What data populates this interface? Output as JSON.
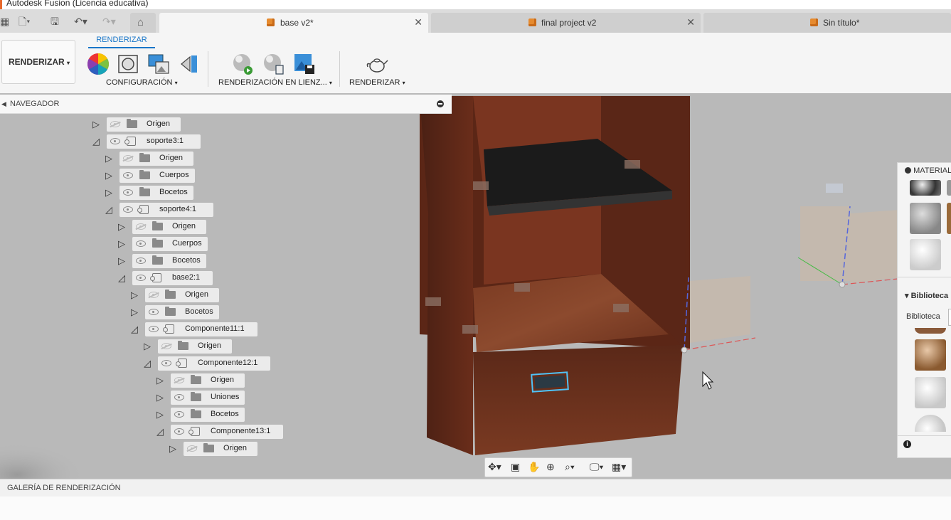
{
  "window": {
    "title": "Autodesk Fusion (Licencia educativa)"
  },
  "tabs": [
    {
      "label": "base v2*",
      "active": true
    },
    {
      "label": "final project v2",
      "active": false
    },
    {
      "label": "Sin título*",
      "active": false
    }
  ],
  "ribbon": {
    "workspace_label": "RENDERIZAR",
    "active_tab": "RENDERIZAR",
    "groups": {
      "configuracion": "CONFIGURACIÓN",
      "en_lienzo": "RENDERIZACIÓN EN LIENZ...",
      "renderizar": "RENDERIZAR"
    }
  },
  "navigator": {
    "title": "NAVEGADOR",
    "items": [
      {
        "label": "Origen",
        "type": "folder",
        "level": 0,
        "expanded": false,
        "visible": false
      },
      {
        "label": "soporte3:1",
        "type": "component",
        "level": 0,
        "expanded": true,
        "visible": true
      },
      {
        "label": "Origen",
        "type": "folder",
        "level": 1,
        "expanded": false,
        "visible": false
      },
      {
        "label": "Cuerpos",
        "type": "folder",
        "level": 1,
        "expanded": false,
        "visible": true
      },
      {
        "label": "Bocetos",
        "type": "folder",
        "level": 1,
        "expanded": false,
        "visible": true
      },
      {
        "label": "soporte4:1",
        "type": "component",
        "level": 1,
        "expanded": true,
        "visible": true
      },
      {
        "label": "Origen",
        "type": "folder",
        "level": 2,
        "expanded": false,
        "visible": false
      },
      {
        "label": "Cuerpos",
        "type": "folder",
        "level": 2,
        "expanded": false,
        "visible": true
      },
      {
        "label": "Bocetos",
        "type": "folder",
        "level": 2,
        "expanded": false,
        "visible": true
      },
      {
        "label": "base2:1",
        "type": "component",
        "level": 2,
        "expanded": true,
        "visible": true
      },
      {
        "label": "Origen",
        "type": "folder",
        "level": 3,
        "expanded": false,
        "visible": false
      },
      {
        "label": "Bocetos",
        "type": "folder",
        "level": 3,
        "expanded": false,
        "visible": true
      },
      {
        "label": "Componente11:1",
        "type": "component",
        "level": 3,
        "expanded": true,
        "visible": true
      },
      {
        "label": "Origen",
        "type": "folder",
        "level": 4,
        "expanded": false,
        "visible": false
      },
      {
        "label": "Componente12:1",
        "type": "component",
        "level": 4,
        "expanded": true,
        "visible": true
      },
      {
        "label": "Origen",
        "type": "folder",
        "level": 5,
        "expanded": false,
        "visible": false
      },
      {
        "label": "Uniones",
        "type": "folder",
        "level": 5,
        "expanded": false,
        "visible": true
      },
      {
        "label": "Bocetos",
        "type": "folder",
        "level": 5,
        "expanded": false,
        "visible": true
      },
      {
        "label": "Componente13:1",
        "type": "component",
        "level": 5,
        "expanded": true,
        "visible": true
      },
      {
        "label": "Origen",
        "type": "folder",
        "level": 6,
        "expanded": false,
        "visible": false
      }
    ]
  },
  "materials": {
    "title": "MATERIAL",
    "library_section": "Biblioteca",
    "library_label": "Biblioteca"
  },
  "bottom": {
    "gallery_label": "GALERÍA DE RENDERIZACIÓN"
  },
  "colors": {
    "accent": "#1976c8",
    "wood": "#6e3520",
    "viewport": "#b9b9b9"
  }
}
